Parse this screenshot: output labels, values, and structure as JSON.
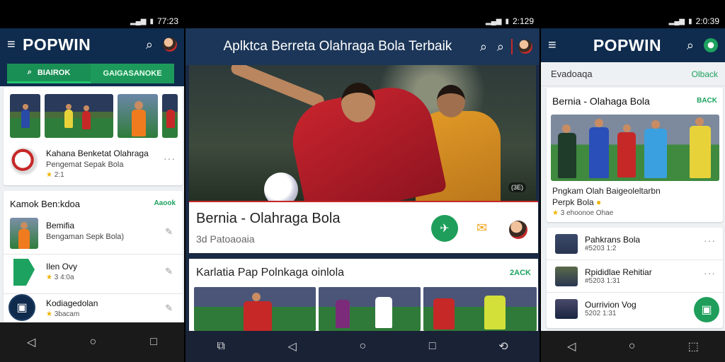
{
  "screen1": {
    "status_time": "77:23",
    "logo": "POPWIN",
    "tabs": [
      "BIAIROK",
      "GAIGASANOKE"
    ],
    "featured": {
      "title": "Kahana Benketat Olahraga",
      "subtitle": "Pengemat Sepak Bola",
      "rating": "2:1"
    },
    "section_title": "Kamok Ben:kdoa",
    "section_link": "Aaook",
    "list": [
      {
        "title": "Bemifia",
        "subtitle": "Bengaman Sepk Bola)"
      },
      {
        "title": "Ilen Ovy",
        "subtitle": "3 4:0a"
      },
      {
        "title": "Kodiagedolan",
        "subtitle": "3bacam"
      }
    ]
  },
  "screen2": {
    "status_time": "2:129",
    "title": "Aplktca Berreta Olahraga Bola Terbaik",
    "hero_badge": "(3E)",
    "main_card": {
      "title": "Bernia - Olahraga Bola",
      "subtitle": "3d Patoaoaia"
    },
    "section_title": "Karlatia Pap Polnkaga oinlola",
    "section_link": "2ACK"
  },
  "screen3": {
    "status_time": "2:0:39",
    "logo": "POPWIN",
    "top_label": "Evadoaqa",
    "top_link": "Olback",
    "card": {
      "title": "Bernia - Olahaga Bola",
      "link": "BACK",
      "desc_line1": "Pngkam Olah Baigeoleltarbn",
      "desc_line2": "Perpk Bola",
      "meta": "3 ehoonoe Ohae"
    },
    "list": [
      {
        "title": "Pahkrans Bola",
        "meta": "#5203 1:2"
      },
      {
        "title": "Rpididlae Rehitiar",
        "meta": "#5203 1:31"
      },
      {
        "title": "Ourrivion Vog",
        "meta": "5202 1:31"
      }
    ]
  }
}
